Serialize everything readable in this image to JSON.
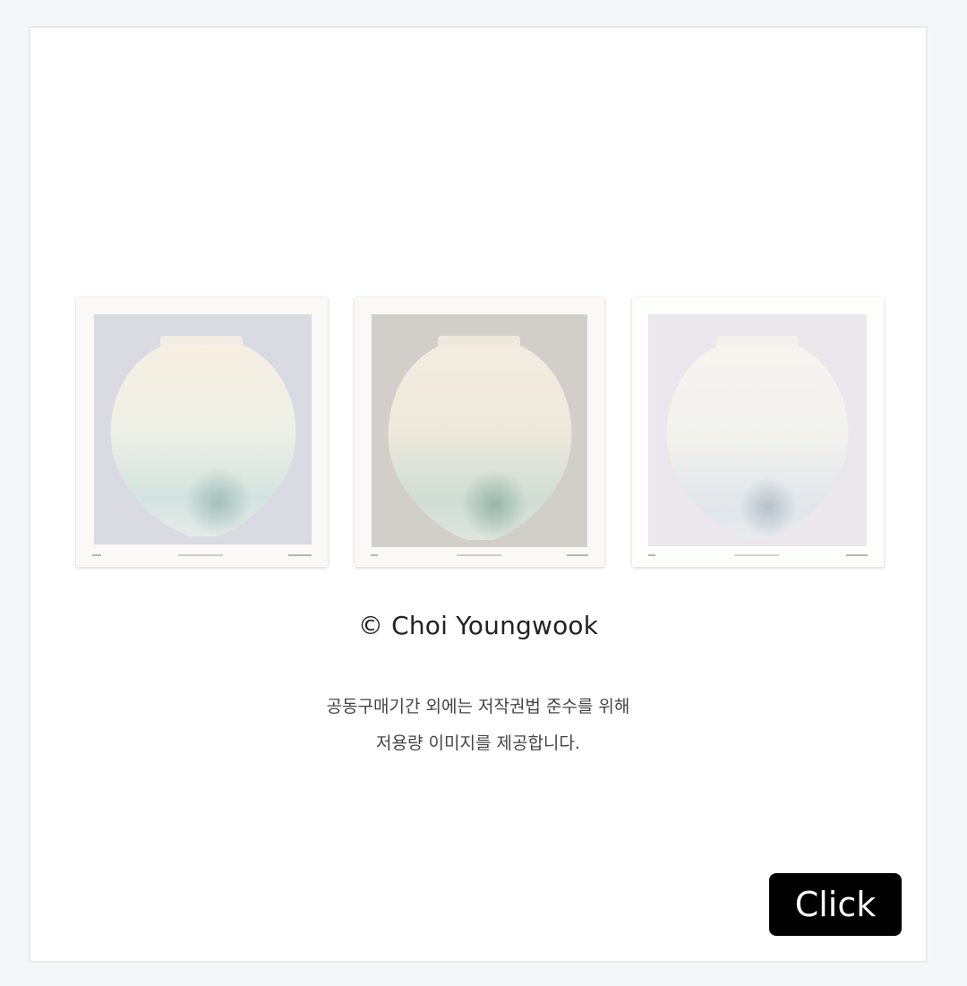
{
  "credit": {
    "text": "© Choi Youngwook"
  },
  "notice": {
    "line1": "공동구매기간 외에는 저작권법 준수를 위해",
    "line2": "저용량 이미지를 제공합니다."
  },
  "button": {
    "label": "Click"
  },
  "colors": {
    "background": "#f5f6f8",
    "card": "#ffffff",
    "button": "#000000",
    "print1_bg": "#d9dae2",
    "print2_bg": "#d2cfcb",
    "print3_bg": "#ebe7ec"
  },
  "artworks": [
    {
      "icon": "moon-jar-print"
    },
    {
      "icon": "moon-jar-print"
    },
    {
      "icon": "moon-jar-print"
    }
  ]
}
